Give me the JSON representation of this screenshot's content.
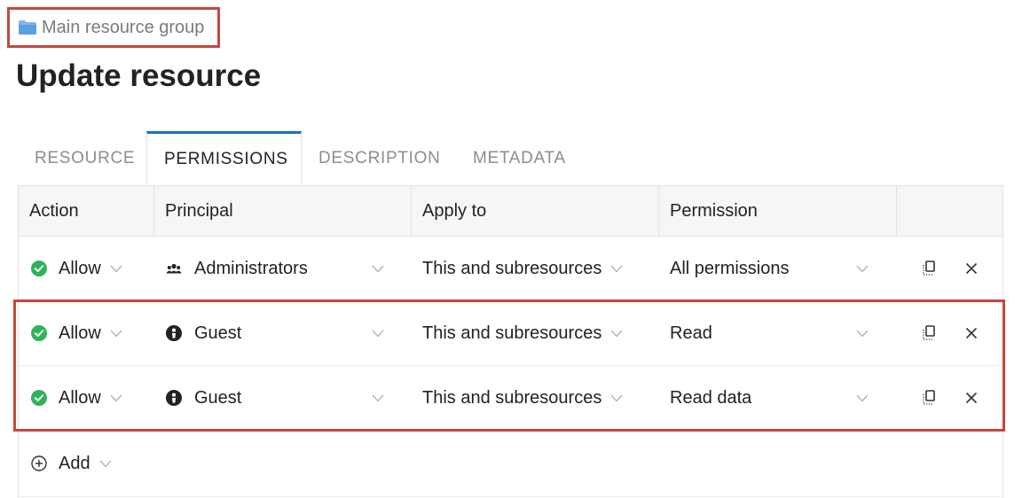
{
  "breadcrumb": {
    "label": "Main resource group",
    "icon": "folder-icon"
  },
  "page": {
    "title": "Update resource"
  },
  "tabs": [
    {
      "label": "RESOURCE",
      "active": false
    },
    {
      "label": "PERMISSIONS",
      "active": true
    },
    {
      "label": "DESCRIPTION",
      "active": false
    },
    {
      "label": "METADATA",
      "active": false
    }
  ],
  "table": {
    "headers": {
      "action": "Action",
      "principal": "Principal",
      "apply_to": "Apply to",
      "permission": "Permission"
    },
    "rows": [
      {
        "action": "Allow",
        "principal": "Administrators",
        "principal_icon": "group-icon",
        "apply_to": "This and subresources",
        "permission": "All permissions"
      },
      {
        "action": "Allow",
        "principal": "Guest",
        "principal_icon": "guest-user-icon",
        "apply_to": "This and subresources",
        "permission": "Read"
      },
      {
        "action": "Allow",
        "principal": "Guest",
        "principal_icon": "guest-user-icon",
        "apply_to": "This and subresources",
        "permission": "Read data"
      }
    ],
    "add_label": "Add"
  },
  "colors": {
    "accent": "#1f6fc5",
    "allow_green": "#2fb35a",
    "highlight_red": "#c9463d"
  }
}
